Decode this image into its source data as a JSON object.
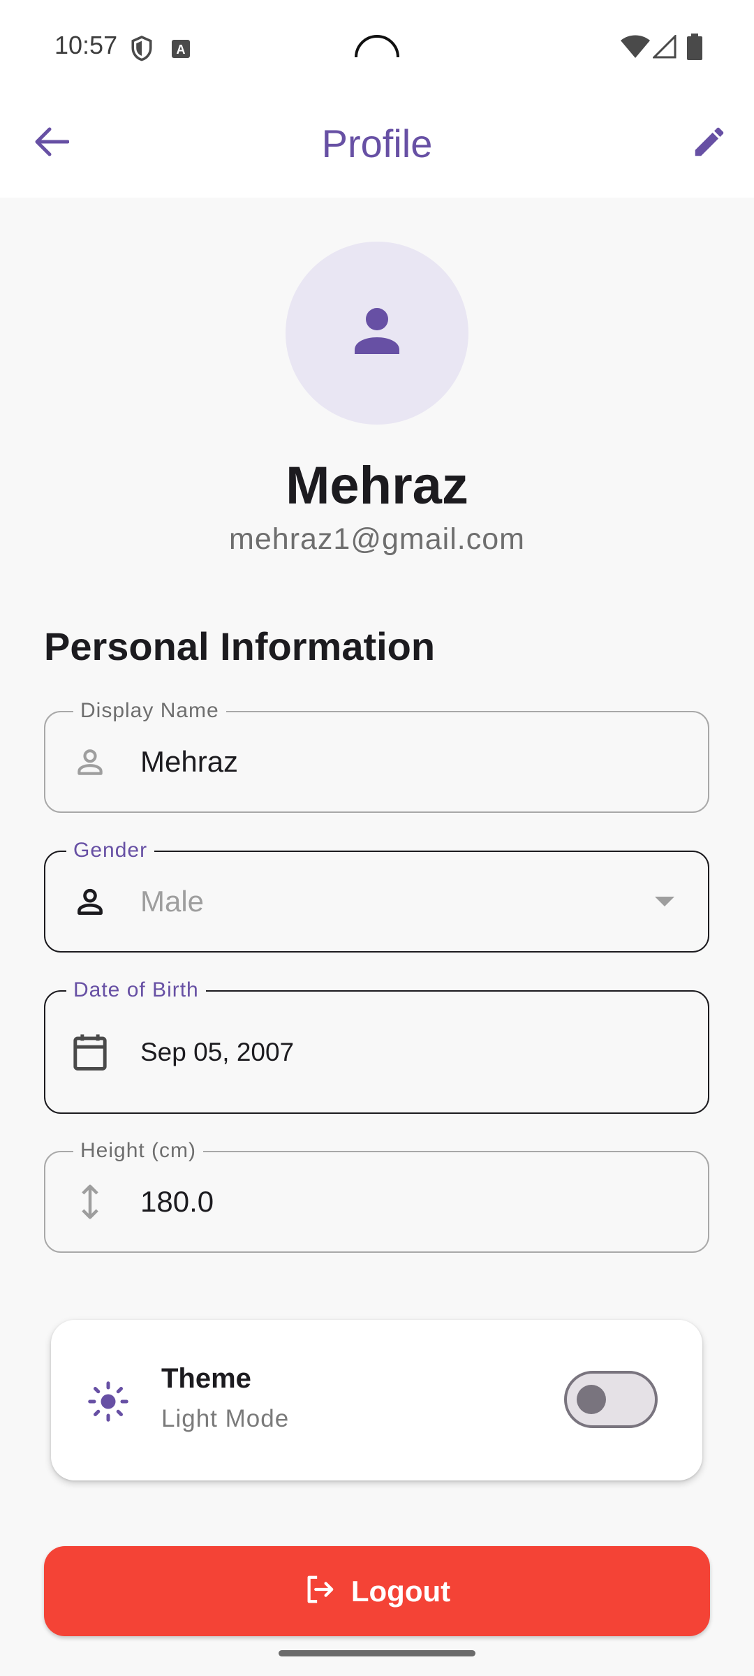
{
  "status_bar": {
    "time": "10:57"
  },
  "app_bar": {
    "title": "Profile",
    "back_icon": "arrow-back-icon",
    "edit_icon": "edit-pencil-icon"
  },
  "profile": {
    "avatar_icon": "person-icon",
    "name": "Mehraz",
    "email": "mehraz1@gmail.com"
  },
  "section": {
    "title": "Personal Information"
  },
  "fields": {
    "display_name": {
      "label": "Display Name",
      "value": "Mehraz",
      "icon": "person-outline-icon"
    },
    "gender": {
      "label": "Gender",
      "value": "Male",
      "icon": "person-icon"
    },
    "date_of_birth": {
      "label": "Date of Birth",
      "value": "Sep 05, 2007",
      "icon": "calendar-icon"
    },
    "height": {
      "label": "Height (cm)",
      "value": "180.0",
      "icon": "vertical-arrows-icon"
    }
  },
  "theme": {
    "title": "Theme",
    "subtitle": "Light Mode",
    "icon": "sun-icon",
    "dark_mode_on": false
  },
  "logout": {
    "label": "Logout",
    "icon": "logout-icon"
  },
  "colors": {
    "accent": "#6750a4",
    "logout": "#f44336"
  }
}
